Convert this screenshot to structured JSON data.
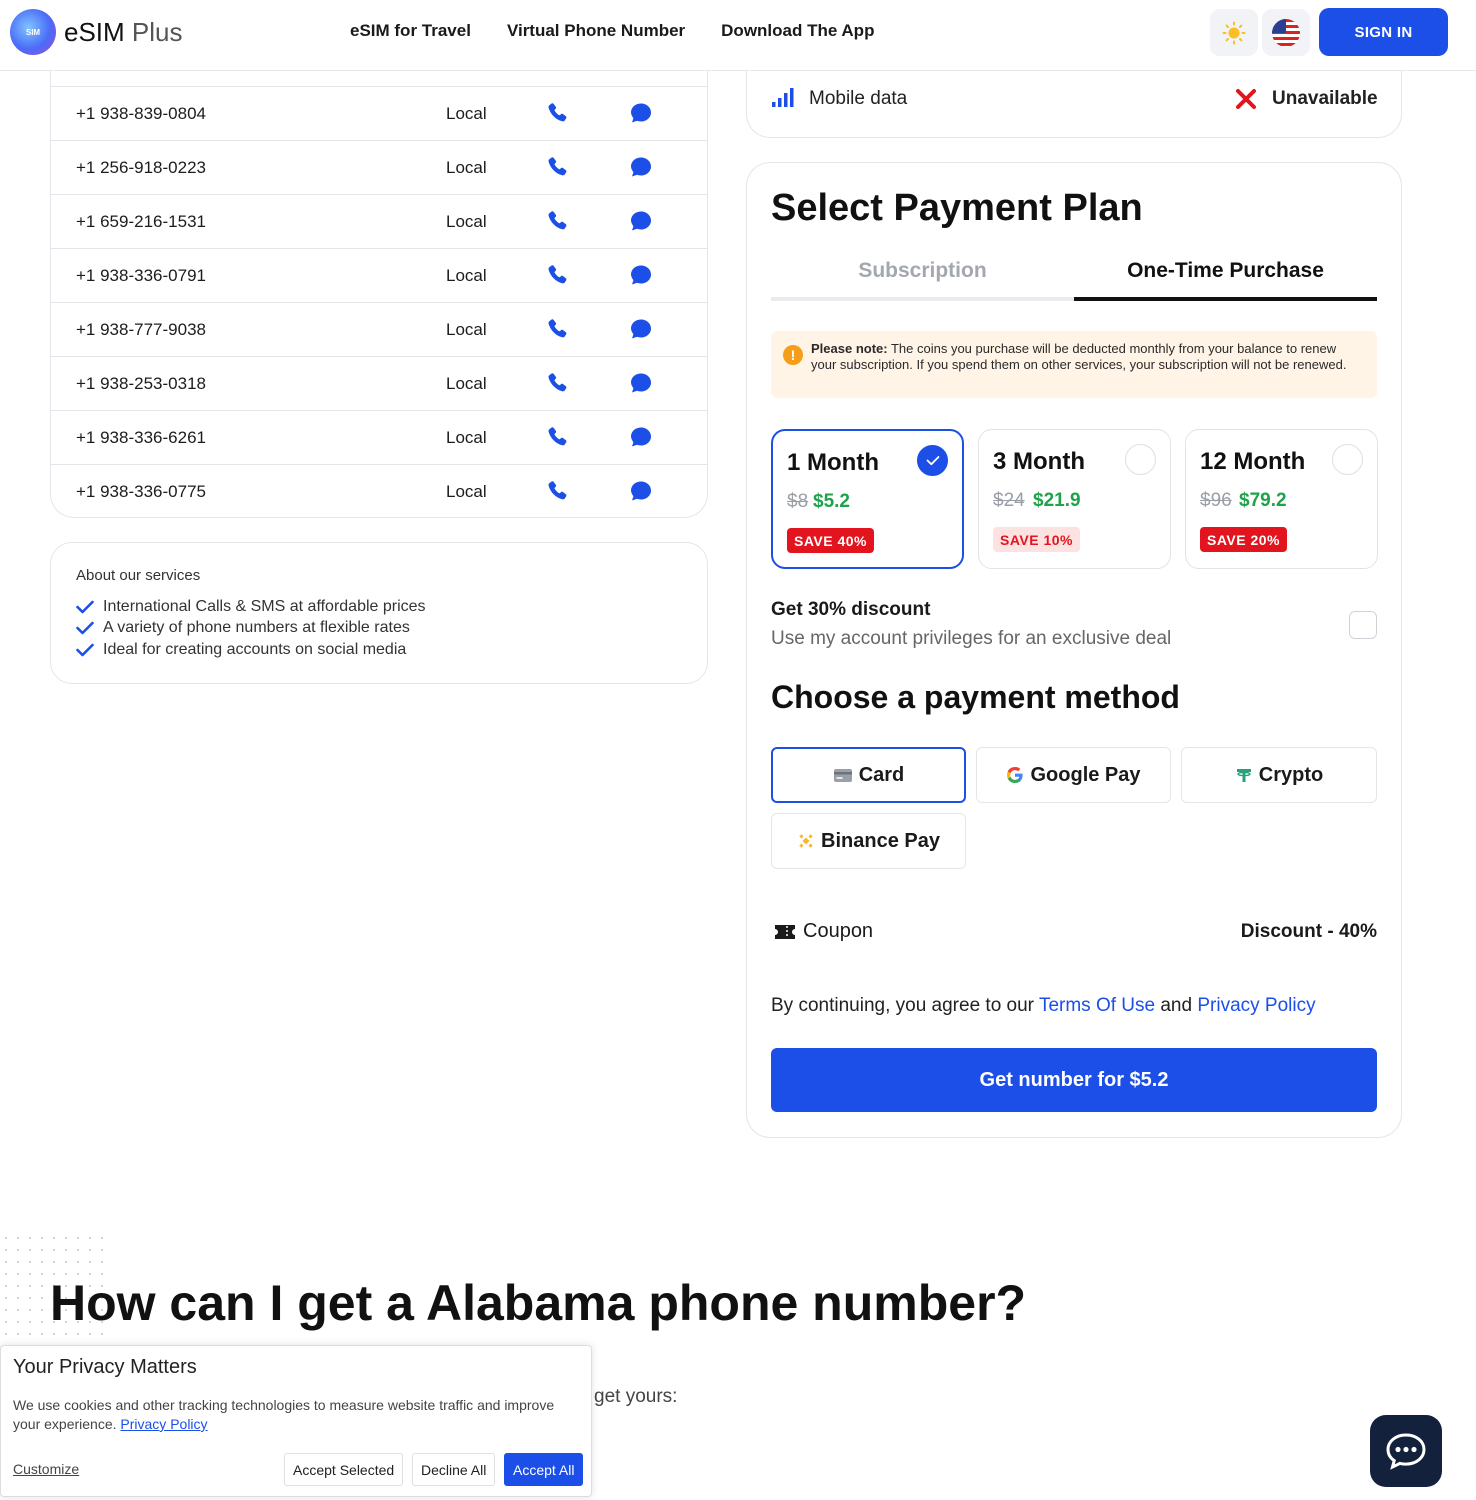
{
  "header": {
    "logo_badge": "SIM",
    "logo_main": "eSIM",
    "logo_plus": "Plus",
    "nav": [
      "eSIM for Travel",
      "Virtual Phone Number",
      "Download The App"
    ],
    "signin_label": "SIGN IN"
  },
  "numbers": [
    {
      "number": "+1 938-839-0804",
      "type": "Local"
    },
    {
      "number": "+1 256-918-0223",
      "type": "Local"
    },
    {
      "number": "+1 659-216-1531",
      "type": "Local"
    },
    {
      "number": "+1 938-336-0791",
      "type": "Local"
    },
    {
      "number": "+1 938-777-9038",
      "type": "Local"
    },
    {
      "number": "+1 938-253-0318",
      "type": "Local"
    },
    {
      "number": "+1 938-336-6261",
      "type": "Local"
    },
    {
      "number": "+1 938-336-0775",
      "type": "Local"
    }
  ],
  "about": {
    "title": "About our services",
    "items": [
      "International Calls & SMS at affordable prices",
      "A variety of phone numbers at flexible rates",
      "Ideal for creating accounts on social media"
    ]
  },
  "features": {
    "label": "Mobile data",
    "value": "Unavailable"
  },
  "payment": {
    "title": "Select Payment Plan",
    "tabs": [
      "Subscription",
      "One-Time Purchase"
    ],
    "active_tab": "One-Time Purchase",
    "note_bold": "Please note:",
    "note_text": "The coins you purchase will be deducted monthly from your balance to renew your subscription. If you spend them on other services, your subscription will not be renewed.",
    "plans": [
      {
        "name": "1 Month",
        "old_price": "$8",
        "new_price": "$5.2",
        "save": "SAVE 40%",
        "selected": true
      },
      {
        "name": "3 Month",
        "old_price": "$24",
        "new_price": "$21.9",
        "save": "SAVE 10%",
        "selected": false
      },
      {
        "name": "12 Month",
        "old_price": "$96",
        "new_price": "$79.2",
        "save": "SAVE 20%",
        "selected": false
      }
    ],
    "discount_title": "Get 30% discount",
    "discount_sub": "Use my account privileges for an exclusive deal",
    "method_title": "Choose a payment method",
    "methods": [
      "Card",
      "Google Pay",
      "Crypto",
      "Binance Pay"
    ],
    "selected_method": "Card",
    "coupon_label": "Coupon",
    "discount_label": "Discount - 40%",
    "agree_prefix": "By continuing, you agree to our",
    "terms_link": "Terms Of Use",
    "agree_and": "and",
    "privacy_link": "Privacy Policy",
    "cta_label": "Get number for $5.2"
  },
  "faq": {
    "title": "How can I get a Alabama phone number?",
    "fragment": "get yours:"
  },
  "cookie": {
    "title": "Your Privacy Matters",
    "text": "We use cookies and other tracking technologies to measure website traffic and improve your experience.",
    "policy_link": "Privacy Policy",
    "customize": "Customize",
    "accept_selected": "Accept Selected",
    "decline_all": "Decline All",
    "accept_all": "Accept All"
  },
  "colors": {
    "accent": "#1b4fe8",
    "save_red": "#e2141d",
    "price_green": "#1ea34a",
    "note_bg": "#fff4e6"
  }
}
